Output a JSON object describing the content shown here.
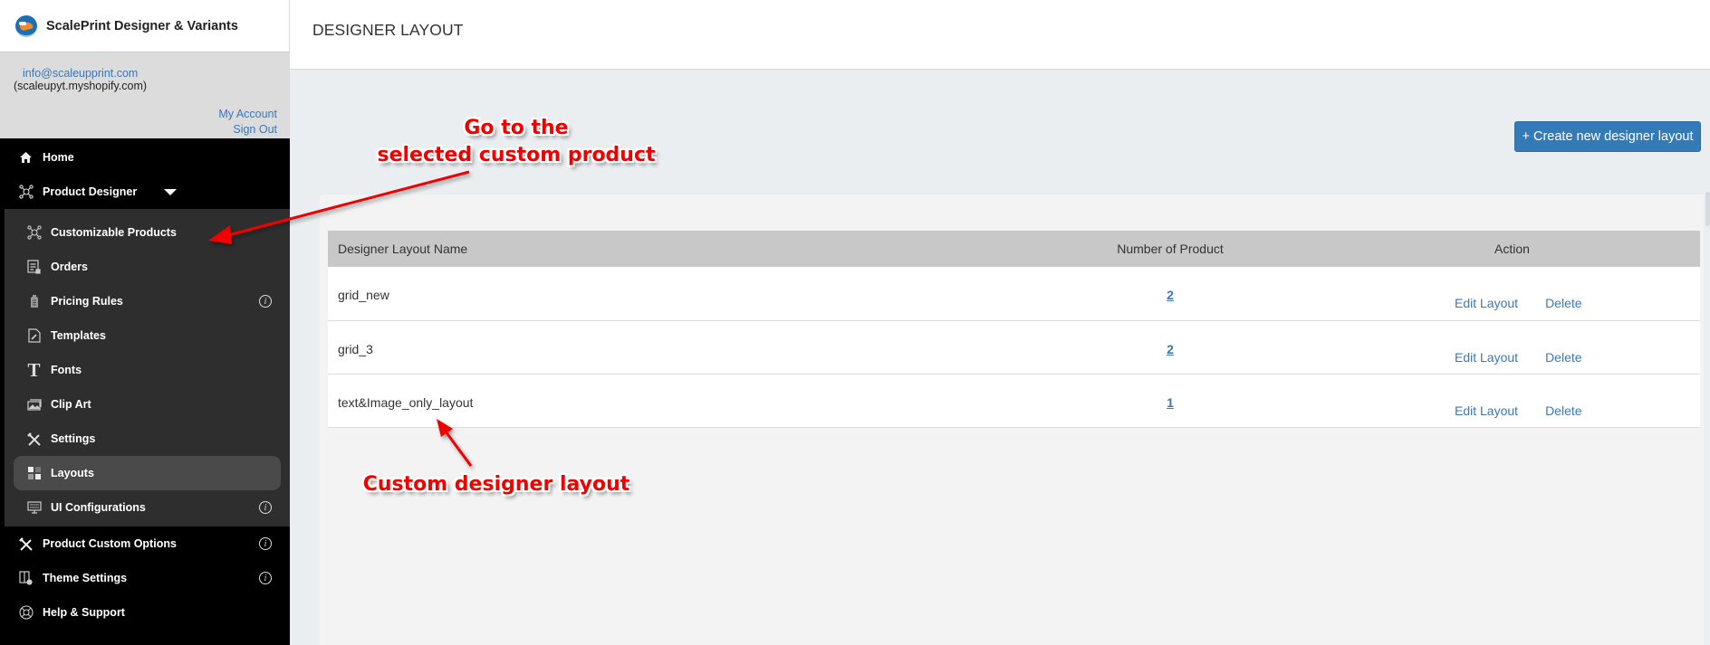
{
  "sidebar": {
    "brand": {
      "title": "ScalePrint Designer & Variants",
      "logo_icon": "scaleprint-logo"
    },
    "account": {
      "email": "info@scaleupprint.com",
      "shop": "(scaleupyt.myshopify.com)",
      "my_account": "My Account",
      "sign_out": "Sign Out"
    },
    "top_items": [
      {
        "label": "Home",
        "icon": "home-icon"
      },
      {
        "label": "Product Designer",
        "icon": "product-designer-icon",
        "expanded": true
      }
    ],
    "submenu": [
      {
        "label": "Customizable Products",
        "icon": "customizable-products-icon"
      },
      {
        "label": "Orders",
        "icon": "orders-icon"
      },
      {
        "label": "Pricing Rules",
        "icon": "pricing-rules-icon",
        "info": "i"
      },
      {
        "label": "Templates",
        "icon": "templates-icon"
      },
      {
        "label": "Fonts",
        "icon": "fonts-icon",
        "glyph": "T"
      },
      {
        "label": "Clip Art",
        "icon": "clip-art-icon"
      },
      {
        "label": "Settings",
        "icon": "settings-icon"
      },
      {
        "label": "Layouts",
        "icon": "layouts-icon",
        "active": true
      },
      {
        "label": "UI Configurations",
        "icon": "ui-configurations-icon",
        "info": "i"
      }
    ],
    "bottom_items": [
      {
        "label": "Product Custom Options",
        "icon": "product-custom-options-icon",
        "info": "i"
      },
      {
        "label": "Theme Settings",
        "icon": "theme-settings-icon",
        "info": "i"
      },
      {
        "label": "Help & Support",
        "icon": "help-support-icon"
      }
    ]
  },
  "header": {
    "title": "DESIGNER LAYOUT"
  },
  "toolbar": {
    "create_label": "+ Create new designer layout"
  },
  "table": {
    "columns": [
      "Designer Layout Name",
      "Number of Product",
      "Action"
    ],
    "rows": [
      {
        "name": "grid_new",
        "count": "2",
        "edit": "Edit Layout",
        "delete": "Delete"
      },
      {
        "name": "grid_3",
        "count": "2",
        "edit": "Edit Layout",
        "delete": "Delete"
      },
      {
        "name": "text&Image_only_layout",
        "count": "1",
        "edit": "Edit Layout",
        "delete": "Delete"
      }
    ]
  },
  "annotations": {
    "go_to_line1": "Go to the",
    "go_to_line2": "selected custom product",
    "custom_layout": "Custom designer layout",
    "color": "#f20000"
  },
  "colors": {
    "primary_button": "#337ab7",
    "link": "#3a78b8",
    "sidebar_bg": "#000000",
    "submenu_bg": "#2e2e2e",
    "active_item_bg": "#4a4a4a"
  }
}
